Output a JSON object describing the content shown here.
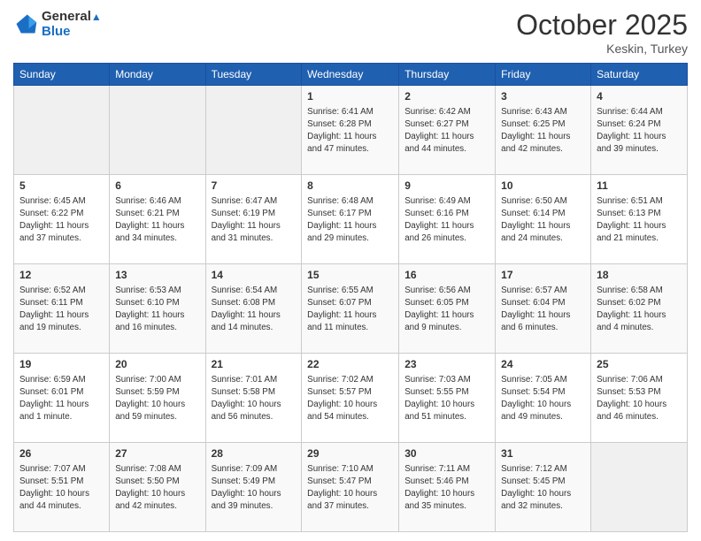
{
  "header": {
    "logo_line1": "General",
    "logo_line2": "Blue",
    "month": "October 2025",
    "location": "Keskin, Turkey"
  },
  "weekdays": [
    "Sunday",
    "Monday",
    "Tuesday",
    "Wednesday",
    "Thursday",
    "Friday",
    "Saturday"
  ],
  "weeks": [
    [
      {
        "day": "",
        "info": ""
      },
      {
        "day": "",
        "info": ""
      },
      {
        "day": "",
        "info": ""
      },
      {
        "day": "1",
        "info": "Sunrise: 6:41 AM\nSunset: 6:28 PM\nDaylight: 11 hours\nand 47 minutes."
      },
      {
        "day": "2",
        "info": "Sunrise: 6:42 AM\nSunset: 6:27 PM\nDaylight: 11 hours\nand 44 minutes."
      },
      {
        "day": "3",
        "info": "Sunrise: 6:43 AM\nSunset: 6:25 PM\nDaylight: 11 hours\nand 42 minutes."
      },
      {
        "day": "4",
        "info": "Sunrise: 6:44 AM\nSunset: 6:24 PM\nDaylight: 11 hours\nand 39 minutes."
      }
    ],
    [
      {
        "day": "5",
        "info": "Sunrise: 6:45 AM\nSunset: 6:22 PM\nDaylight: 11 hours\nand 37 minutes."
      },
      {
        "day": "6",
        "info": "Sunrise: 6:46 AM\nSunset: 6:21 PM\nDaylight: 11 hours\nand 34 minutes."
      },
      {
        "day": "7",
        "info": "Sunrise: 6:47 AM\nSunset: 6:19 PM\nDaylight: 11 hours\nand 31 minutes."
      },
      {
        "day": "8",
        "info": "Sunrise: 6:48 AM\nSunset: 6:17 PM\nDaylight: 11 hours\nand 29 minutes."
      },
      {
        "day": "9",
        "info": "Sunrise: 6:49 AM\nSunset: 6:16 PM\nDaylight: 11 hours\nand 26 minutes."
      },
      {
        "day": "10",
        "info": "Sunrise: 6:50 AM\nSunset: 6:14 PM\nDaylight: 11 hours\nand 24 minutes."
      },
      {
        "day": "11",
        "info": "Sunrise: 6:51 AM\nSunset: 6:13 PM\nDaylight: 11 hours\nand 21 minutes."
      }
    ],
    [
      {
        "day": "12",
        "info": "Sunrise: 6:52 AM\nSunset: 6:11 PM\nDaylight: 11 hours\nand 19 minutes."
      },
      {
        "day": "13",
        "info": "Sunrise: 6:53 AM\nSunset: 6:10 PM\nDaylight: 11 hours\nand 16 minutes."
      },
      {
        "day": "14",
        "info": "Sunrise: 6:54 AM\nSunset: 6:08 PM\nDaylight: 11 hours\nand 14 minutes."
      },
      {
        "day": "15",
        "info": "Sunrise: 6:55 AM\nSunset: 6:07 PM\nDaylight: 11 hours\nand 11 minutes."
      },
      {
        "day": "16",
        "info": "Sunrise: 6:56 AM\nSunset: 6:05 PM\nDaylight: 11 hours\nand 9 minutes."
      },
      {
        "day": "17",
        "info": "Sunrise: 6:57 AM\nSunset: 6:04 PM\nDaylight: 11 hours\nand 6 minutes."
      },
      {
        "day": "18",
        "info": "Sunrise: 6:58 AM\nSunset: 6:02 PM\nDaylight: 11 hours\nand 4 minutes."
      }
    ],
    [
      {
        "day": "19",
        "info": "Sunrise: 6:59 AM\nSunset: 6:01 PM\nDaylight: 11 hours\nand 1 minute."
      },
      {
        "day": "20",
        "info": "Sunrise: 7:00 AM\nSunset: 5:59 PM\nDaylight: 10 hours\nand 59 minutes."
      },
      {
        "day": "21",
        "info": "Sunrise: 7:01 AM\nSunset: 5:58 PM\nDaylight: 10 hours\nand 56 minutes."
      },
      {
        "day": "22",
        "info": "Sunrise: 7:02 AM\nSunset: 5:57 PM\nDaylight: 10 hours\nand 54 minutes."
      },
      {
        "day": "23",
        "info": "Sunrise: 7:03 AM\nSunset: 5:55 PM\nDaylight: 10 hours\nand 51 minutes."
      },
      {
        "day": "24",
        "info": "Sunrise: 7:05 AM\nSunset: 5:54 PM\nDaylight: 10 hours\nand 49 minutes."
      },
      {
        "day": "25",
        "info": "Sunrise: 7:06 AM\nSunset: 5:53 PM\nDaylight: 10 hours\nand 46 minutes."
      }
    ],
    [
      {
        "day": "26",
        "info": "Sunrise: 7:07 AM\nSunset: 5:51 PM\nDaylight: 10 hours\nand 44 minutes."
      },
      {
        "day": "27",
        "info": "Sunrise: 7:08 AM\nSunset: 5:50 PM\nDaylight: 10 hours\nand 42 minutes."
      },
      {
        "day": "28",
        "info": "Sunrise: 7:09 AM\nSunset: 5:49 PM\nDaylight: 10 hours\nand 39 minutes."
      },
      {
        "day": "29",
        "info": "Sunrise: 7:10 AM\nSunset: 5:47 PM\nDaylight: 10 hours\nand 37 minutes."
      },
      {
        "day": "30",
        "info": "Sunrise: 7:11 AM\nSunset: 5:46 PM\nDaylight: 10 hours\nand 35 minutes."
      },
      {
        "day": "31",
        "info": "Sunrise: 7:12 AM\nSunset: 5:45 PM\nDaylight: 10 hours\nand 32 minutes."
      },
      {
        "day": "",
        "info": ""
      }
    ]
  ]
}
